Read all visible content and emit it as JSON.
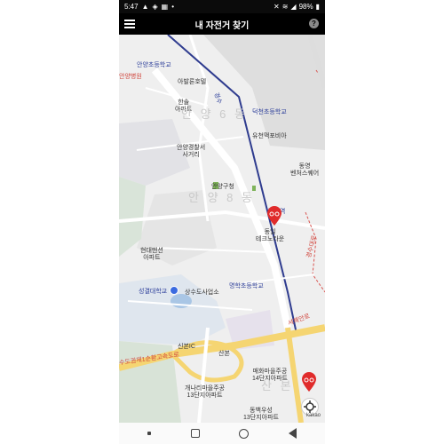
{
  "status_bar": {
    "time": "5:47",
    "battery": "98%",
    "icons": [
      "warning-icon",
      "shield-icon",
      "calendar-icon",
      "dot-icon",
      "mute-icon",
      "wifi-icon",
      "signal-icon",
      "battery-icon"
    ]
  },
  "app_bar": {
    "title": "내 자전거 찾기",
    "menu_icon": "hamburger-menu-icon",
    "help_label": "?"
  },
  "map": {
    "labels": {
      "anyang_elem": "안양초등학교",
      "abalon_hotel": "아발론호텔",
      "hanul_apt_1": "한솔",
      "hanul_apt_2": "아파트",
      "anyang6dong": "안 양 6 동",
      "police_1": "안양경찰서",
      "police_2": "사거리",
      "anyanggucheong": "안양구청",
      "anyang8dong": "안 양 8 동",
      "deokcheon_elem": "덕천초등학교",
      "yuchun": "유천맥포비아",
      "dongyang_1": "동영",
      "dongyang_2": "벤처스퀘어",
      "myeonghak_stn": "명학역",
      "dongil_1": "동일",
      "dongil_2": "테크노타운",
      "hyundai_1": "현대맨션",
      "hyundai_2": "아파트",
      "seonggyeol_univ": "성결대학교",
      "sangsu_office": "상수도사업소",
      "myeonghak_elem": "명학초등학교",
      "sinbon_ic": "신본IC",
      "sinbon": "산본",
      "seohae_road": "서해안로",
      "suwon_highway": "수도권제1순환고속도로",
      "maehwa_1": "매화마을주공",
      "maehwa_2": "14단지아파트",
      "gaenari_1": "개나리마을주공",
      "gaenari_2": "13단지아파트",
      "dongbo_1": "동백우성",
      "dongbo_2": "13단지아파트",
      "kakao_logo": "kakao",
      "sanbondong": "산 본",
      "hospital": "안양병원",
      "road_1": "경수",
      "road_vert_right": "경수대로"
    },
    "bike_pins": 2,
    "current_location": true
  },
  "nav_bar": {
    "icons": [
      "recents-dot-icon",
      "square-icon",
      "circle-home-icon",
      "triangle-back-icon"
    ]
  },
  "colors": {
    "map_bg": "#eeeeee",
    "road_main": "#f7dc7a",
    "rail": "#2f3c8f",
    "pin_red": "#e02b2b",
    "location_blue": "#3b6be0"
  }
}
